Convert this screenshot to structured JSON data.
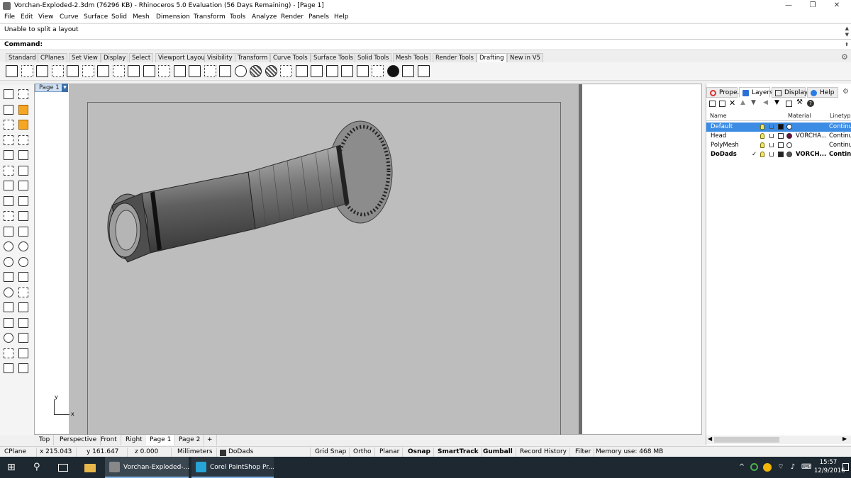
{
  "window": {
    "title": "Vorchan-Exploded-2.3dm (76296 KB) - Rhinoceros 5.0 Evaluation (56 Days Remaining) - [Page 1]",
    "minimize": "—",
    "restore": "❐",
    "close": "✕"
  },
  "menu": [
    "File",
    "Edit",
    "View",
    "Curve",
    "Surface",
    "Solid",
    "Mesh",
    "Dimension",
    "Transform",
    "Tools",
    "Analyze",
    "Render",
    "Panels",
    "Help"
  ],
  "history": {
    "text": "Unable to split a layout"
  },
  "command": {
    "label": "Command:",
    "value": ""
  },
  "toolbar_tabs": [
    {
      "label": "Standard"
    },
    {
      "label": "CPlanes"
    },
    {
      "label": "Set View"
    },
    {
      "label": "Display"
    },
    {
      "label": "Select"
    },
    {
      "label": "Viewport Layout"
    },
    {
      "label": "Visibility"
    },
    {
      "label": "Transform"
    },
    {
      "label": "Curve Tools"
    },
    {
      "label": "Surface Tools"
    },
    {
      "label": "Solid Tools"
    },
    {
      "label": "Mesh Tools"
    },
    {
      "label": "Render Tools"
    },
    {
      "label": "Drafting",
      "active": true
    },
    {
      "label": "New in V5"
    }
  ],
  "drafting_icons": [
    "new-layout-icon",
    "page-icon",
    "page-properties-icon",
    "copy-layout-icon",
    "detail-icon",
    "linear-dimension-icon",
    "aligned-dimension-icon",
    "rotated-dimension-icon",
    "angle-dimension-icon",
    "radius-dimension-icon",
    "diameter-dimension-icon",
    "ordinate-dimension-icon",
    "text-icon",
    "leader-icon",
    "dimension-break-icon",
    "centermark-icon",
    "hatch-icon",
    "hatch-circle-icon",
    "make2d-icon",
    "recess-icon",
    "text-block-icon",
    "text-box-icon",
    "text-object-icon",
    "box-edit-icon",
    "grid-icon",
    "sphere-icon",
    "print-icon",
    "print-setup-icon"
  ],
  "viewport": {
    "tab": "Page 1",
    "axis_y": "y",
    "axis_x": "x"
  },
  "viewport_tabs": [
    {
      "label": "Top"
    },
    {
      "label": "Perspective"
    },
    {
      "label": "Front"
    },
    {
      "label": "Right"
    },
    {
      "label": "Page 1",
      "active": true
    },
    {
      "label": "Page 2"
    },
    {
      "label": "+"
    }
  ],
  "panel_tabs": [
    {
      "label": "Prope...",
      "icon": "properties-icon",
      "color": "#d33"
    },
    {
      "label": "Layers",
      "icon": "layers-icon",
      "color": "#2d6fd6",
      "active": true
    },
    {
      "label": "Display",
      "icon": "display-icon",
      "color": "#333"
    },
    {
      "label": "Help",
      "icon": "help-icon",
      "color": "#2a7be4"
    }
  ],
  "layers": {
    "headers": {
      "name": "Name",
      "material": "Material",
      "linetype": "Linetype"
    },
    "rows": [
      {
        "name": "Default",
        "material": "",
        "linetype": "Continuo",
        "selected": true,
        "swatch": "#111111"
      },
      {
        "name": "Head",
        "material": "VORCHA...",
        "linetype": "Continuo",
        "swatch": "#ffffff",
        "mat_color": "#6a1040"
      },
      {
        "name": "PolyMesh",
        "material": "",
        "linetype": "Continuo",
        "swatch": "#ffffff"
      },
      {
        "name": "DoDads",
        "material": "VORCH...",
        "linetype": "Continuo",
        "check": "✓",
        "bold": true,
        "swatch": "#222222",
        "mat_color": "#555555"
      }
    ]
  },
  "status": {
    "cplane": "CPlane",
    "x": "x 215.043",
    "y": "y 161.647",
    "z": "z 0.000",
    "units": "Millimeters",
    "layer": "DoDads",
    "toggles": [
      {
        "label": "Grid Snap"
      },
      {
        "label": "Ortho"
      },
      {
        "label": "Planar"
      },
      {
        "label": "Osnap",
        "bold": true
      },
      {
        "label": "SmartTrack",
        "bold": true
      },
      {
        "label": "Gumball",
        "bold": true
      },
      {
        "label": "Record History"
      },
      {
        "label": "Filter"
      }
    ],
    "memory": "Memory use: 468 MB"
  },
  "taskbar": {
    "tasks": [
      {
        "label": "Vorchan-Exploded-..."
      },
      {
        "label": "Corel PaintShop Pr..."
      }
    ],
    "time": "15:57",
    "date": "12/9/2016"
  }
}
